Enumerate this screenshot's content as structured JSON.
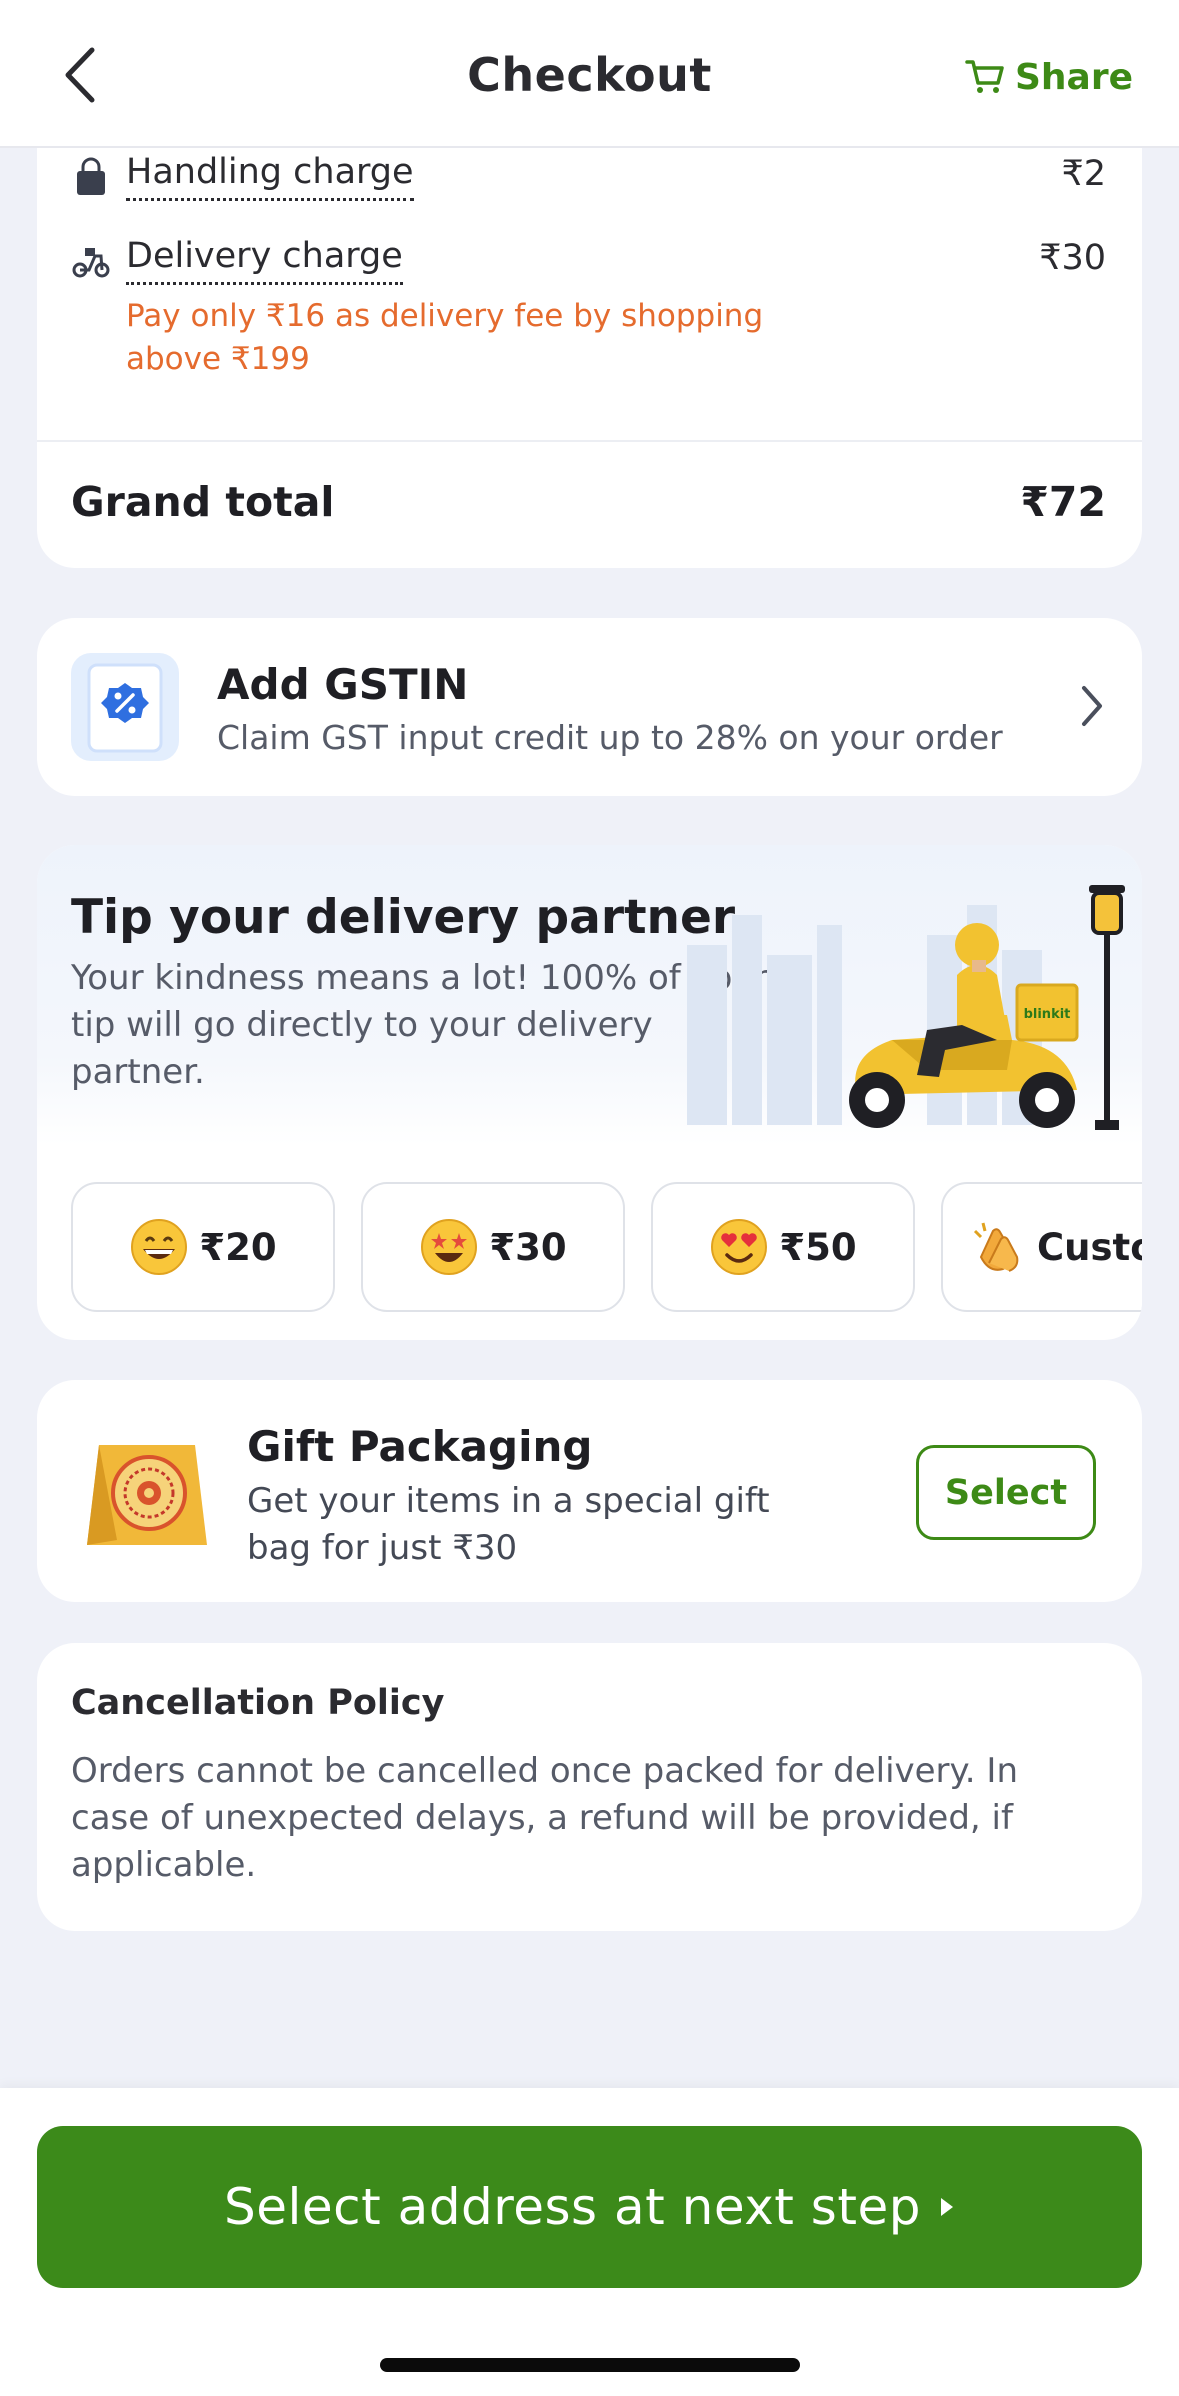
{
  "header": {
    "title": "Checkout",
    "share_label": "Share"
  },
  "bill": {
    "handling_label": "Handling charge",
    "handling_value": "₹2",
    "delivery_label": "Delivery charge",
    "delivery_value": "₹30",
    "delivery_note": "Pay only ₹16 as delivery fee by shopping above ₹199",
    "grand_total_label": "Grand total",
    "grand_total_value": "₹72"
  },
  "gstin": {
    "title": "Add GSTIN",
    "subtitle": "Claim GST input credit up to 28% on your order"
  },
  "tip": {
    "title": "Tip your delivery partner",
    "description": "Your kindness means a lot! 100% of your tip will go directly to your delivery partner.",
    "brand_on_box": "blinkit",
    "options": [
      {
        "label": "₹20",
        "icon": "grinning-emoji-icon"
      },
      {
        "label": "₹30",
        "icon": "star-struck-emoji-icon"
      },
      {
        "label": "₹50",
        "icon": "heart-eyes-emoji-icon"
      },
      {
        "label": "Custom",
        "icon": "clapping-hands-icon"
      }
    ]
  },
  "gift": {
    "title": "Gift Packaging",
    "description": "Get your items in a special gift bag for just ₹30",
    "button_label": "Select"
  },
  "cancellation": {
    "title": "Cancellation Policy",
    "text": "Orders cannot be cancelled once packed for delivery. In case of unexpected delays, a refund will be provided, if applicable."
  },
  "footer": {
    "cta_label": "Select address at next step"
  },
  "colors": {
    "brand_green": "#3c8a1a",
    "accent_orange": "#e56b2e",
    "background": "#eff1f8"
  }
}
